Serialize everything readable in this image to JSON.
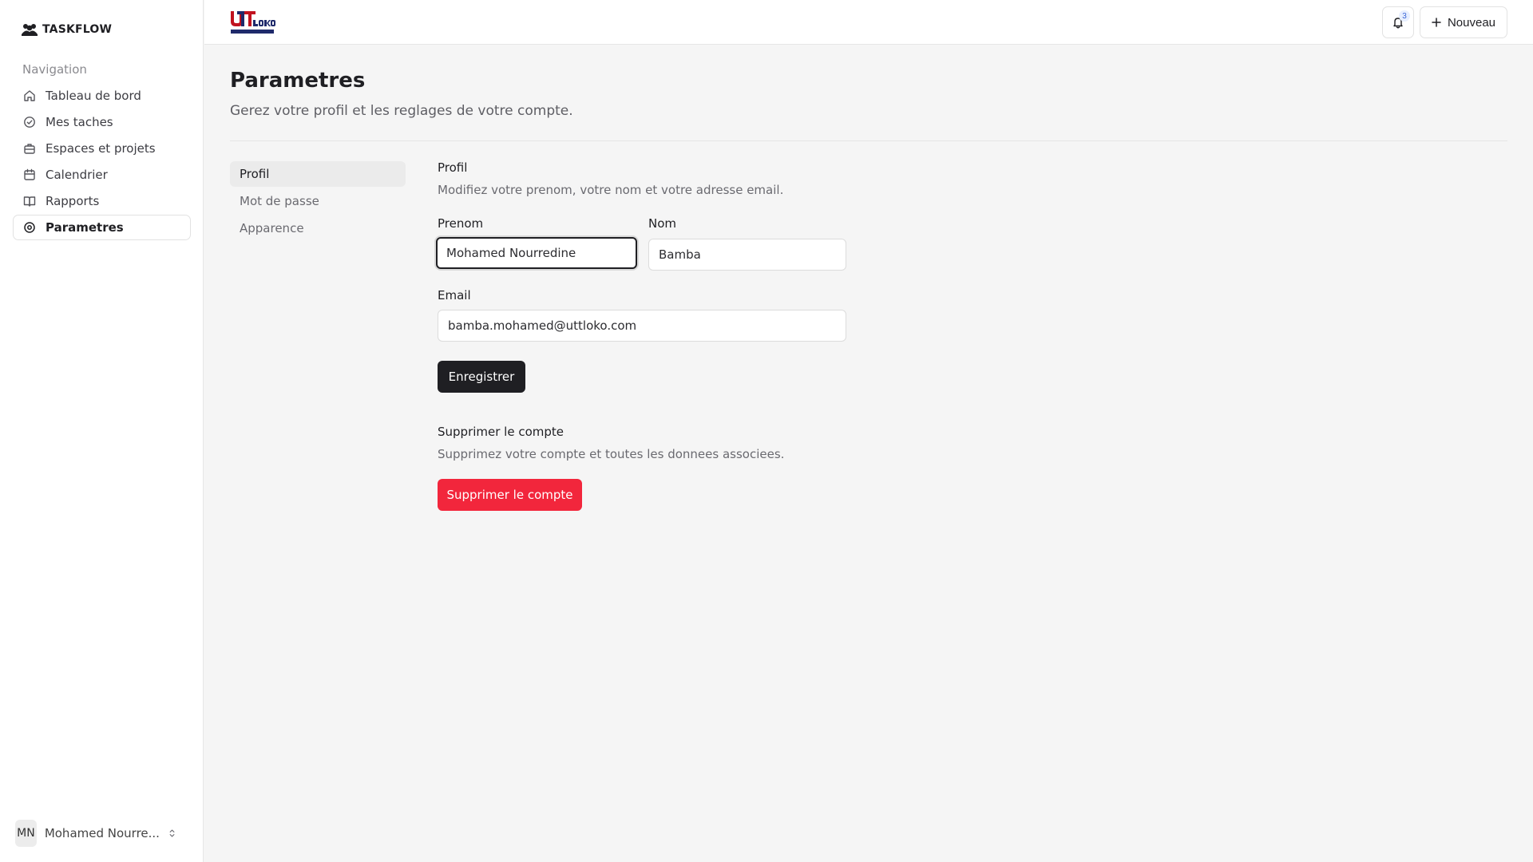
{
  "sidebar": {
    "brand": "TASKFLOW",
    "nav_heading": "Navigation",
    "items": [
      {
        "label": "Tableau de bord",
        "icon": "home-icon"
      },
      {
        "label": "Mes taches",
        "icon": "check-circle-icon"
      },
      {
        "label": "Espaces et projets",
        "icon": "briefcase-icon"
      },
      {
        "label": "Calendrier",
        "icon": "calendar-icon"
      },
      {
        "label": "Rapports",
        "icon": "book-icon"
      },
      {
        "label": "Parametres",
        "icon": "settings-icon",
        "active": true
      }
    ],
    "user": {
      "initials": "MN",
      "name": "Mohamed Nourre..."
    }
  },
  "topbar": {
    "logo_text": "UTT LOKO UNIVERSITE",
    "notifications_count": "3",
    "new_label": "Nouveau"
  },
  "page": {
    "title": "Parametres",
    "subtitle": "Gerez votre profil et les reglages de votre compte."
  },
  "settings_nav": {
    "items": [
      "Profil",
      "Mot de passe",
      "Apparence"
    ],
    "active": "Profil"
  },
  "profile": {
    "title": "Profil",
    "description": "Modifiez votre prenom, votre nom et votre adresse email.",
    "first_name_label": "Prenom",
    "first_name_value": "Mohamed Nourredine",
    "last_name_label": "Nom",
    "last_name_value": "Bamba",
    "email_label": "Email",
    "email_value": "bamba.mohamed@uttloko.com",
    "save_label": "Enregistrer"
  },
  "delete_account": {
    "title": "Supprimer le compte",
    "description": "Supprimez votre compte et toutes les donnees associees.",
    "button_label": "Supprimer le compte"
  },
  "colors": {
    "primary": "#1f1f23",
    "danger": "#f2263c",
    "background": "#f5f5f5"
  }
}
